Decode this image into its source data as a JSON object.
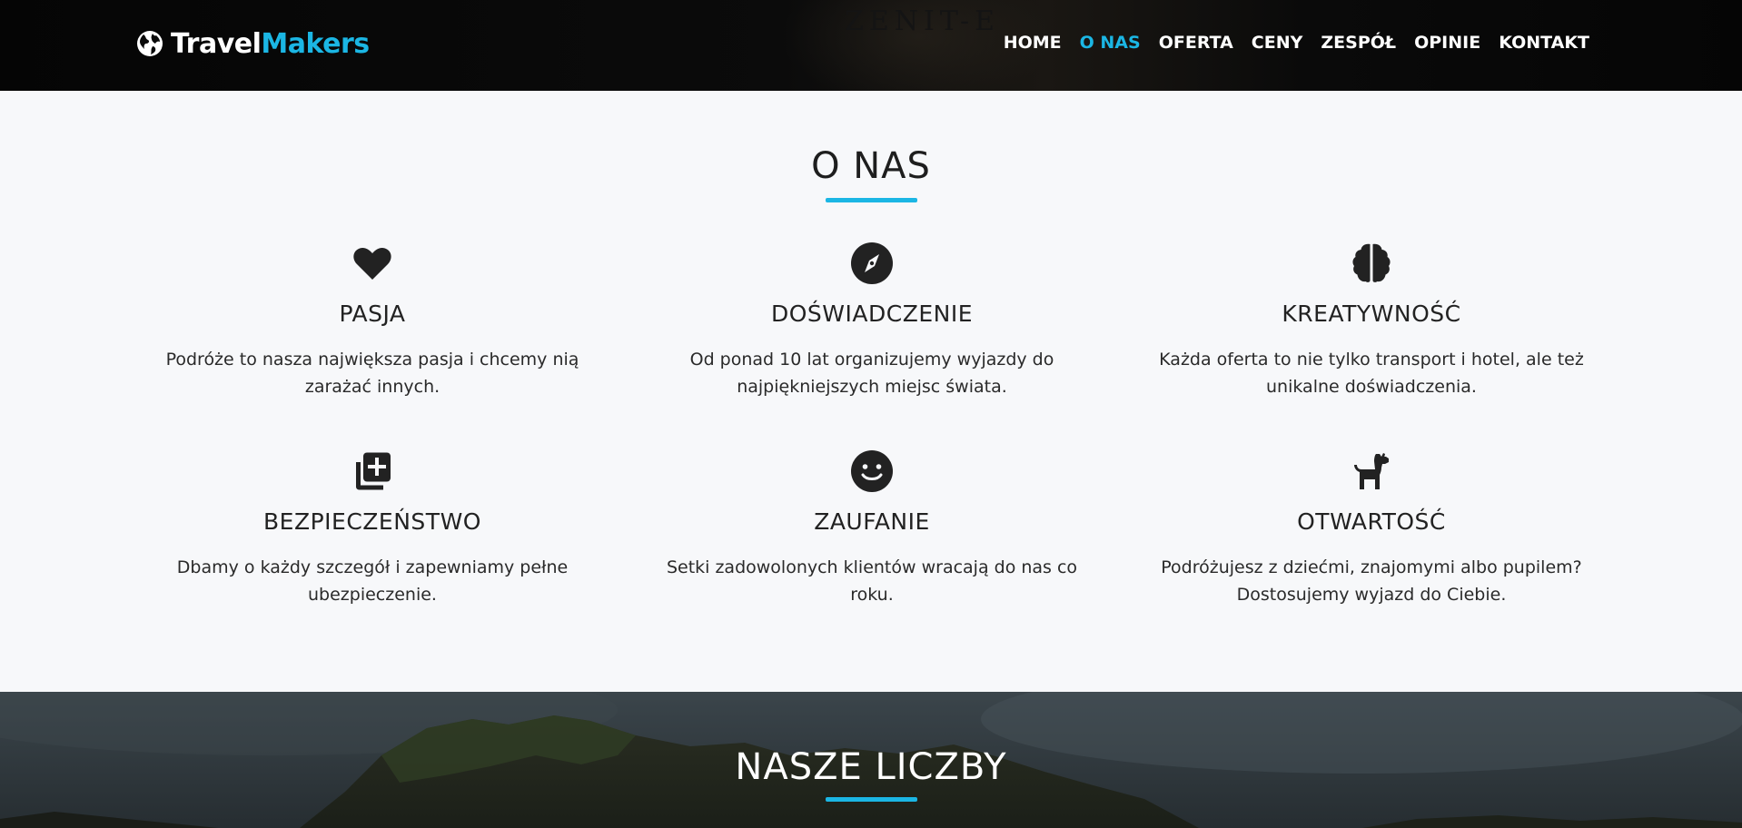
{
  "header": {
    "brand_part1": "Travel",
    "brand_part2": "Makers",
    "background_text": "ZENIT-E",
    "nav": [
      {
        "label": "HOME",
        "active": false
      },
      {
        "label": "O NAS",
        "active": true
      },
      {
        "label": "OFERTA",
        "active": false
      },
      {
        "label": "CENY",
        "active": false
      },
      {
        "label": "ZESPÓŁ",
        "active": false
      },
      {
        "label": "OPINIE",
        "active": false
      },
      {
        "label": "KONTAKT",
        "active": false
      }
    ]
  },
  "about": {
    "title": "O NAS",
    "features": [
      {
        "icon": "heart-icon",
        "title": "PASJA",
        "text": "Podróże to nasza największa pasja i chcemy nią zarażać innych."
      },
      {
        "icon": "compass-icon",
        "title": "DOŚWIADCZENIE",
        "text": "Od ponad 10 lat organizujemy wyjazdy do najpiękniejszych miejsc świata."
      },
      {
        "icon": "brain-icon",
        "title": "KREATYWNOŚĆ",
        "text": "Każda oferta to nie tylko transport i hotel, ale też unikalne doświadczenia."
      },
      {
        "icon": "medical-plus-icon",
        "title": "BEZPIECZEŃSTWO",
        "text": "Dbamy o każdy szczegół i zapewniamy pełne ubezpieczenie."
      },
      {
        "icon": "smile-icon",
        "title": "ZAUFANIE",
        "text": "Setki zadowolonych klientów wracają do nas co roku."
      },
      {
        "icon": "dog-icon",
        "title": "OTWARTOŚĆ",
        "text": "Podróżujesz z dziećmi, znajomymi albo pupilem? Dostosujemy wyjazd do Ciebie."
      }
    ]
  },
  "numbers": {
    "title": "NASZE LICZBY"
  },
  "colors": {
    "accent": "#1bb6e4",
    "nav_bg": "#050505",
    "section_bg": "#f7f8fa",
    "icon": "#222222"
  }
}
